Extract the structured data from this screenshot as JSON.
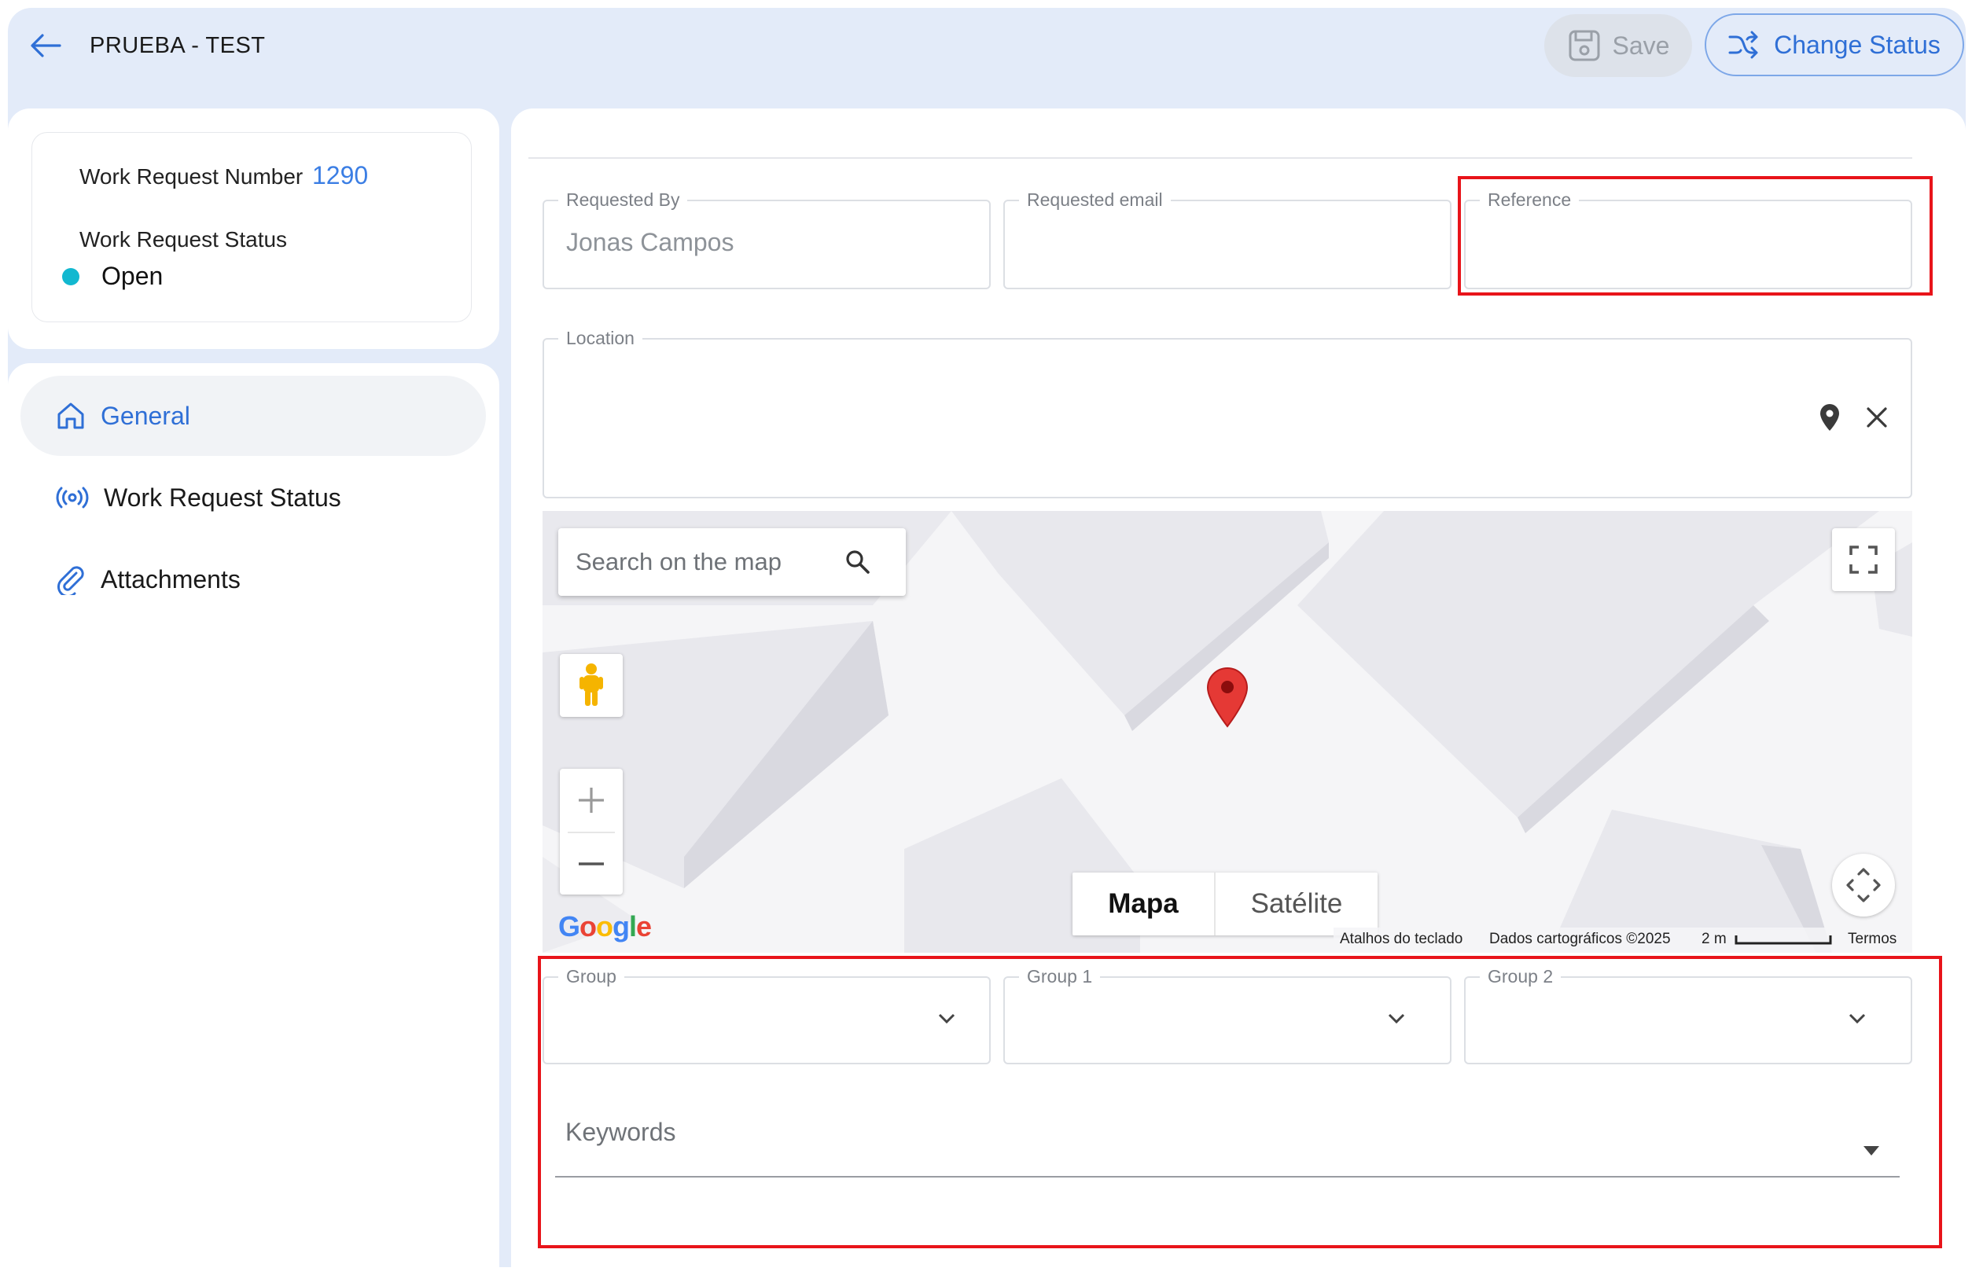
{
  "header": {
    "title": "PRUEBA - TEST",
    "save_label": "Save",
    "change_status_label": "Change Status"
  },
  "info": {
    "number_label": "Work Request Number",
    "number_value": "1290",
    "status_label": "Work Request Status",
    "status_value": "Open",
    "status_color": "#12b8d0"
  },
  "nav": {
    "items": [
      {
        "label": "General",
        "icon": "home-icon",
        "active": true
      },
      {
        "label": "Work Request Status",
        "icon": "broadcast-icon",
        "active": false
      },
      {
        "label": "Attachments",
        "icon": "paperclip-icon",
        "active": false
      }
    ]
  },
  "form": {
    "requested_by": {
      "label": "Requested By",
      "value": "Jonas Campos"
    },
    "requested_email": {
      "label": "Requested email",
      "value": ""
    },
    "reference": {
      "label": "Reference",
      "value": ""
    },
    "location": {
      "label": "Location",
      "value": ""
    },
    "group": {
      "label": "Group",
      "value": ""
    },
    "group1": {
      "label": "Group 1",
      "value": ""
    },
    "group2": {
      "label": "Group 2",
      "value": ""
    },
    "keywords": {
      "label": "Keywords"
    }
  },
  "map": {
    "search_placeholder": "Search on the map",
    "type_map": "Mapa",
    "type_satellite": "Satélite",
    "keyboard_shortcuts": "Atalhos do teclado",
    "map_data": "Dados cartográficos ©2025",
    "scale": "2 m",
    "terms": "Termos",
    "google": "Google"
  },
  "colors": {
    "accent": "#2f6fd6",
    "header_bg": "#e3ebf9",
    "highlight_border": "#e8141a"
  }
}
